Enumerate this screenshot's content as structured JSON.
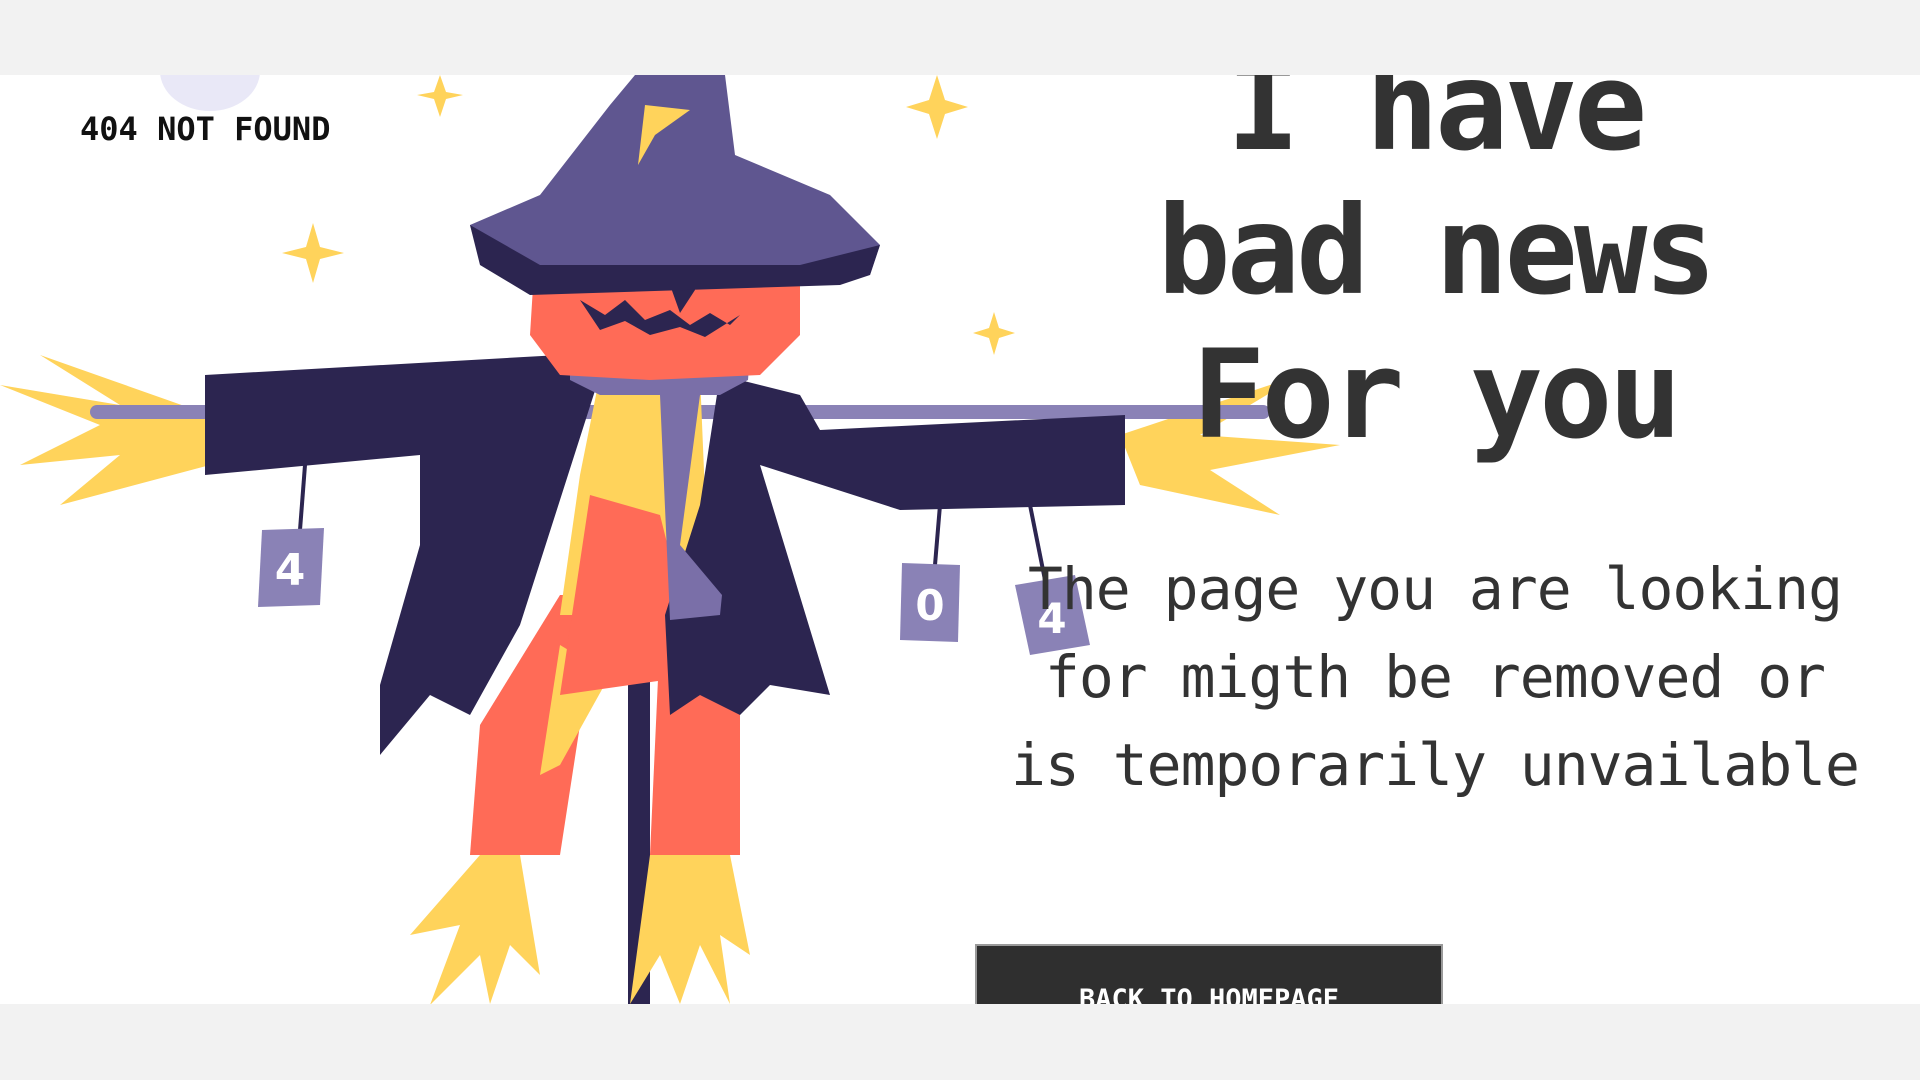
{
  "header": {
    "brand": "404 NOT FOUND"
  },
  "main": {
    "headline": [
      "I have",
      "bad news",
      "For you"
    ],
    "message": "The page you are looking for migth be removed or is temporarily unvailable",
    "button_label": "BACK TO HOMEPAGE"
  },
  "illustration": {
    "can_labels": [
      "4",
      "0",
      "4"
    ],
    "colors": {
      "hat": "#5f5690",
      "coat": "#2c2550",
      "face": "#ff6b57",
      "straw": "#ffd35b",
      "scarf": "#7a6fa8"
    }
  }
}
